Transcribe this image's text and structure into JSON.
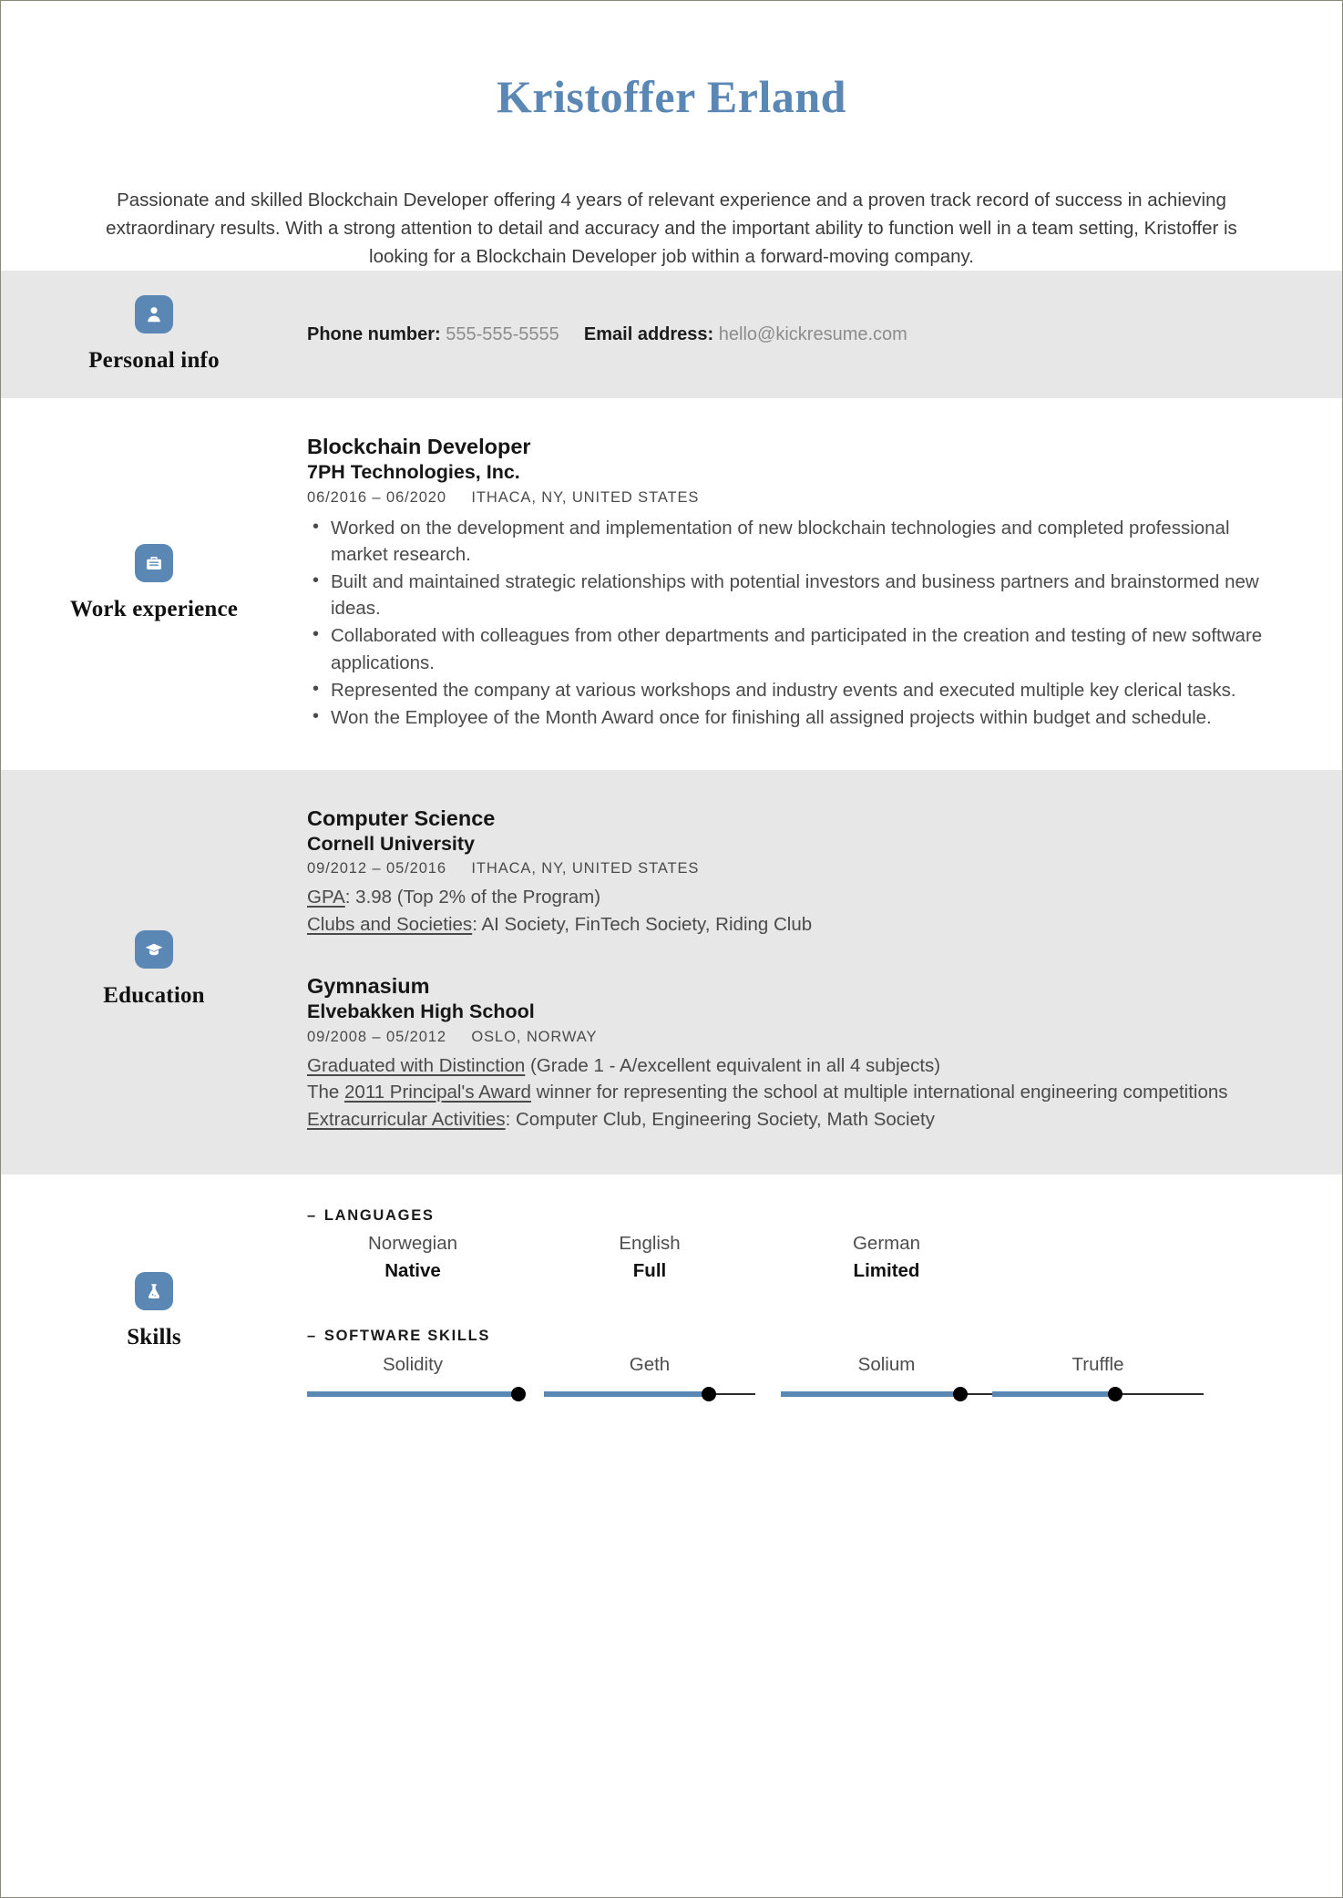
{
  "colors": {
    "accent": "#5b87b5",
    "band_grey": "#e7e7e7",
    "text_body": "#4a4a4a",
    "text_heading": "#161616",
    "knob": "#000000"
  },
  "header": {
    "name": "Kristoffer Erland",
    "summary": "Passionate and skilled Blockchain Developer offering 4 years of relevant experience and a proven track record of success in achieving extraordinary results. With a strong attention to detail and accuracy and the important ability to function well in a team setting, Kristoffer is looking for a Blockchain Developer job within a forward-moving company."
  },
  "sections": {
    "personal": {
      "label": "Personal info",
      "icon": "person-icon",
      "phone_label": "Phone number:",
      "phone_value": "555-555-5555",
      "email_label": "Email address:",
      "email_value": "hello@kickresume.com"
    },
    "work": {
      "label": "Work experience",
      "icon": "briefcase-icon",
      "entries": [
        {
          "title": "Blockchain Developer",
          "org": "7PH Technologies, Inc.",
          "dates": "06/2016 – 06/2020",
          "location": "ITHACA, NY, UNITED STATES",
          "bullets": [
            "Worked on the development and implementation of new blockchain technologies and completed professional market research.",
            "Built and maintained strategic relationships with potential investors and business partners and brainstormed new ideas.",
            "Collaborated with colleagues from other departments and participated in the creation and testing of new software applications.",
            "Represented the company at various workshops and industry events and executed multiple key clerical tasks.",
            "Won the Employee of the Month Award once for finishing all assigned projects within budget and schedule."
          ]
        }
      ]
    },
    "education": {
      "label": "Education",
      "icon": "graduation-cap-icon",
      "entries": [
        {
          "title": "Computer Science",
          "org": "Cornell University",
          "dates": "09/2012 – 05/2016",
          "location": "ITHACA, NY, UNITED STATES",
          "notes": [
            {
              "underlined": "GPA",
              "rest": ": 3.98 (Top 2% of the Program)"
            },
            {
              "underlined": "Clubs and Societies",
              "rest": ": AI Society, FinTech Society, Riding Club"
            }
          ]
        },
        {
          "title": "Gymnasium",
          "org": "Elvebakken High School",
          "dates": "09/2008 – 05/2012",
          "location": "OSLO, NORWAY",
          "notes": [
            {
              "underlined": "Graduated with Distinction",
              "rest": " (Grade 1 - A/excellent equivalent in all 4 subjects)"
            },
            {
              "pre": "The ",
              "underlined": "2011 Principal's Award",
              "rest": " winner for representing the school at multiple international engineering competitions"
            },
            {
              "underlined": "Extracurricular Activities",
              "rest": ": Computer Club, Engineering Society, Math Society"
            }
          ]
        }
      ]
    },
    "skills": {
      "label": "Skills",
      "icon": "flask-icon",
      "groups": [
        {
          "dash": "–",
          "title": "LANGUAGES",
          "type": "languages",
          "items": [
            {
              "name": "Norwegian",
              "level": "Native"
            },
            {
              "name": "English",
              "level": "Full"
            },
            {
              "name": "German",
              "level": "Limited"
            }
          ]
        },
        {
          "dash": "–",
          "title": "SOFTWARE SKILLS",
          "type": "bars",
          "items": [
            {
              "name": "Solidity",
              "percent": 100
            },
            {
              "name": "Geth",
              "percent": 78
            },
            {
              "name": "Solium",
              "percent": 85
            },
            {
              "name": "Truffle",
              "percent": 58
            }
          ]
        }
      ]
    }
  }
}
